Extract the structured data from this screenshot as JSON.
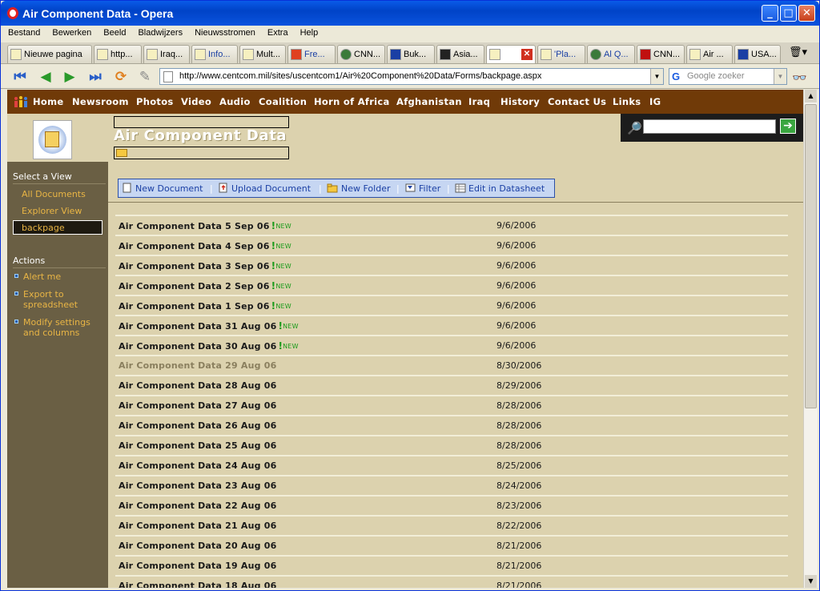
{
  "window": {
    "title": "Air Component Data - Opera",
    "minimize": "_",
    "maximize": "□",
    "close": "✕"
  },
  "menu": [
    "Bestand",
    "Bewerken",
    "Beeld",
    "Bladwijzers",
    "Nieuwsstromen",
    "Extra",
    "Help"
  ],
  "tabs": [
    {
      "label": "Nieuwe pagina",
      "icon": "page-icon"
    },
    {
      "label": "http...",
      "icon": "page-icon"
    },
    {
      "label": "Iraq...",
      "icon": "ic-icon"
    },
    {
      "label": "Info...",
      "icon": "page-icon"
    },
    {
      "label": "Mult...",
      "icon": "page-icon"
    },
    {
      "label": "Fre...",
      "icon": "site-icon"
    },
    {
      "label": "CNN...",
      "icon": "globe-icon"
    },
    {
      "label": "Buk...",
      "icon": "bl-icon"
    },
    {
      "label": "Asia...",
      "icon": "at-icon"
    },
    {
      "label": "",
      "icon": "page-icon"
    },
    {
      "label": "'Pla...",
      "icon": "cfr-icon"
    },
    {
      "label": "Al Q...",
      "icon": "globe-icon"
    },
    {
      "label": "CNN...",
      "icon": "cnn-icon"
    },
    {
      "label": "Air ...",
      "icon": "page-icon"
    },
    {
      "label": "USA...",
      "icon": "usa-icon"
    }
  ],
  "address": {
    "url": "http://www.centcom.mil/sites/uscentcom1/Air%20Component%20Data/Forms/backpage.aspx",
    "search_placeholder": "Google zoeker",
    "search_engine": "G"
  },
  "site_nav": [
    "Home",
    "Newsroom",
    "Photos",
    "Video",
    "Audio",
    "Coalition",
    "Horn of Africa",
    "Afghanistan",
    "Iraq",
    "History",
    "Contact Us",
    "Links",
    "IG"
  ],
  "banner": {
    "title": "Air Component Data"
  },
  "sidebar": {
    "select_view_header": "Select a View",
    "views": [
      "All Documents",
      "Explorer View",
      "backpage"
    ],
    "actions_header": "Actions",
    "actions": [
      "Alert me",
      "Export to spreadsheet",
      "Modify settings and columns"
    ]
  },
  "toolbar": {
    "new_document": "New Document",
    "upload_document": "Upload Document",
    "new_folder": "New Folder",
    "filter": "Filter",
    "edit_in_datasheet": "Edit in Datasheet",
    "separator": "|"
  },
  "new_badge": "NEW",
  "documents": [
    {
      "name": "Air Component Data 5 Sep 06",
      "date": "9/6/2006",
      "is_new": true
    },
    {
      "name": "Air Component Data 4 Sep 06",
      "date": "9/6/2006",
      "is_new": true
    },
    {
      "name": "Air Component Data 3 Sep 06",
      "date": "9/6/2006",
      "is_new": true
    },
    {
      "name": "Air Component Data 2 Sep 06",
      "date": "9/6/2006",
      "is_new": true
    },
    {
      "name": "Air Component Data 1 Sep 06",
      "date": "9/6/2006",
      "is_new": true
    },
    {
      "name": "Air Component Data 31 Aug 06",
      "date": "9/6/2006",
      "is_new": true
    },
    {
      "name": "Air Component Data 30 Aug 06",
      "date": "9/6/2006",
      "is_new": true
    },
    {
      "name": "Air Component Data 29 Aug 06",
      "date": "8/30/2006",
      "is_new": false,
      "visited": true
    },
    {
      "name": "Air Component Data 28 Aug 06",
      "date": "8/29/2006",
      "is_new": false
    },
    {
      "name": "Air Component Data 27 Aug 06",
      "date": "8/28/2006",
      "is_new": false
    },
    {
      "name": "Air Component Data 26 Aug 06",
      "date": "8/28/2006",
      "is_new": false
    },
    {
      "name": "Air Component Data 25 Aug 06",
      "date": "8/28/2006",
      "is_new": false
    },
    {
      "name": "Air Component Data 24 Aug 06",
      "date": "8/25/2006",
      "is_new": false
    },
    {
      "name": "Air Component Data 23 Aug 06",
      "date": "8/24/2006",
      "is_new": false
    },
    {
      "name": "Air Component Data 22 Aug 06",
      "date": "8/23/2006",
      "is_new": false
    },
    {
      "name": "Air Component Data 21 Aug 06",
      "date": "8/22/2006",
      "is_new": false
    },
    {
      "name": "Air Component Data 20 Aug 06",
      "date": "8/21/2006",
      "is_new": false
    },
    {
      "name": "Air Component Data 19 Aug 06",
      "date": "8/21/2006",
      "is_new": false
    },
    {
      "name": "Air Component Data 18 Aug 06",
      "date": "8/21/2006",
      "is_new": false
    }
  ]
}
